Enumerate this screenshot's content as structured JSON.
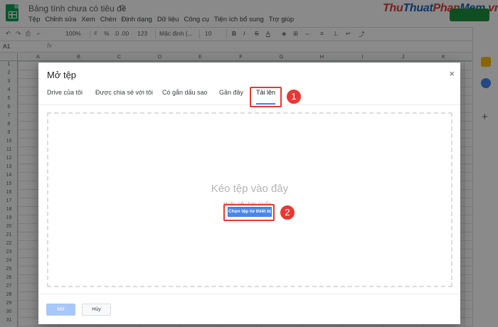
{
  "app": {
    "doc_title": "Bảng tính chưa có tiêu đề",
    "menu": [
      "Tệp",
      "Chỉnh sửa",
      "Xem",
      "Chèn",
      "Định dạng",
      "Dữ liệu",
      "Công cụ",
      "Tiện ích bổ sung",
      "Trợ giúp"
    ]
  },
  "brand": {
    "part1": "Thu",
    "part2": "Thuat",
    "part3": "Phan",
    "part4": "Mem",
    "part5": ".vn"
  },
  "toolbar": {
    "zoom": "100%",
    "currency": "%",
    "decimals": ".0 .00",
    "format": "123",
    "font": "Mặc định (...",
    "font_size": "10",
    "bold": "B",
    "italic": "I",
    "strike": "S",
    "text_color": "A"
  },
  "formula_bar": {
    "cell_ref": "A1",
    "fx": "fx"
  },
  "grid": {
    "columns": [
      "A",
      "B",
      "C",
      "D",
      "E",
      "F",
      "G",
      "H",
      "I",
      "J",
      "K"
    ],
    "rows": [
      "1",
      "2",
      "3",
      "4",
      "5",
      "6",
      "7",
      "8",
      "9",
      "10",
      "11",
      "12",
      "13",
      "14",
      "15",
      "16",
      "17",
      "18",
      "19",
      "20",
      "21",
      "22",
      "23",
      "24",
      "25",
      "26",
      "27",
      "28",
      "29",
      "30",
      "31"
    ]
  },
  "dialog": {
    "title": "Mở tệp",
    "close": "×",
    "tabs": [
      "Drive của tôi",
      "Được chia sẻ với tôi",
      "Có gắn dấu sao",
      "Gần đây",
      "Tải lên"
    ],
    "active_tab": "Tải lên",
    "drop_text": "Kéo tệp vào đây",
    "or_text": "Hoặc nếu bạn muốn...",
    "choose_button": "Chọn tệp từ thiết bị",
    "open_button": "Mở",
    "cancel_button": "Hủy"
  },
  "annotations": {
    "step1": "1",
    "step2": "2"
  },
  "colors": {
    "accent": "#4285f4",
    "highlight": "#e53935",
    "sheets_green": "#0f9d58"
  }
}
